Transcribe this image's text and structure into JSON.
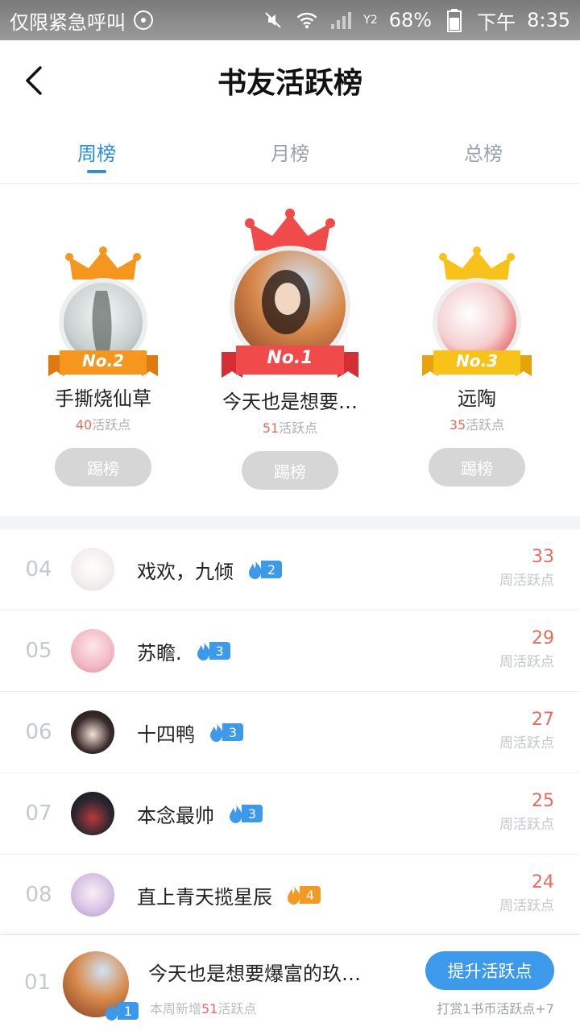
{
  "status_bar": {
    "left_text": "仅限紧急呼叫",
    "battery": "68%",
    "sim_label": "Y2",
    "ampm": "下午",
    "time": "8:35"
  },
  "header": {
    "title": "书友活跃榜"
  },
  "tabs": [
    {
      "label": "周榜",
      "active": true
    },
    {
      "label": "月榜",
      "active": false
    },
    {
      "label": "总榜",
      "active": false
    }
  ],
  "podium": [
    {
      "rank_label": "No.2",
      "name": "手撕烧仙草",
      "points": "40",
      "points_suffix": "活跃点",
      "button": "踢榜",
      "crown_color": "#f5961f"
    },
    {
      "rank_label": "No.1",
      "name": "今天也是想要…",
      "points": "51",
      "points_suffix": "活跃点",
      "button": "踢榜",
      "crown_color": "#f04a4a"
    },
    {
      "rank_label": "No.3",
      "name": "远陶",
      "points": "35",
      "points_suffix": "活跃点",
      "button": "踢榜",
      "crown_color": "#f7c21a"
    }
  ],
  "list": [
    {
      "rank": "04",
      "name": "戏欢，九倾",
      "level": "2",
      "score": "33",
      "score_label": "周活跃点",
      "fire": "blue"
    },
    {
      "rank": "05",
      "name": "苏瞻.",
      "level": "3",
      "score": "29",
      "score_label": "周活跃点",
      "fire": "blue"
    },
    {
      "rank": "06",
      "name": "十四鸭",
      "level": "3",
      "score": "27",
      "score_label": "周活跃点",
      "fire": "blue"
    },
    {
      "rank": "07",
      "name": "本念最帅",
      "level": "3",
      "score": "25",
      "score_label": "周活跃点",
      "fire": "blue"
    },
    {
      "rank": "08",
      "name": "直上青天揽星辰",
      "level": "4",
      "score": "24",
      "score_label": "周活跃点",
      "fire": "orange"
    }
  ],
  "my_rank": {
    "rank": "01",
    "name": "今天也是想要爆富的玖…",
    "level": "1",
    "sub_prefix": "本周新增",
    "sub_points": "51",
    "sub_suffix": "活跃点",
    "button": "提升活跃点",
    "tip": "打赏1书币活跃点+7"
  },
  "colors": {
    "accent": "#3d99ea",
    "score": "#e56b60"
  }
}
